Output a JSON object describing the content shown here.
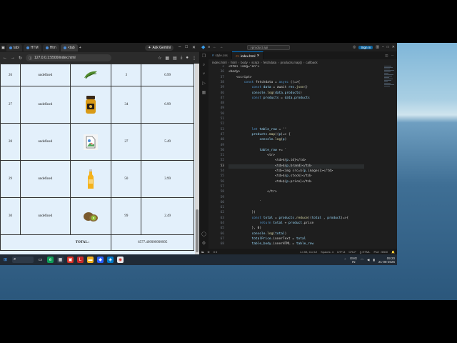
{
  "browser": {
    "tabs": [
      "tabl",
      "HTM",
      "Htm",
      "<tab"
    ],
    "ask_gemini": "Ask Gemini",
    "url": "127.0.0.1:5500/index.html",
    "table": {
      "rows": [
        {
          "id": "26",
          "brand": "undefined",
          "image": "green-bean-icon",
          "stock": "3",
          "price": "0.99"
        },
        {
          "id": "27",
          "brand": "undefined",
          "image": "honey-jar-icon",
          "stock": "34",
          "price": "6.99"
        },
        {
          "id": "28",
          "brand": "undefined",
          "image": "broken-image-icon",
          "stock": "27",
          "price": "5.49"
        },
        {
          "id": "29",
          "brand": "undefined",
          "image": "juice-bottle-icon",
          "stock": "50",
          "price": "3.99"
        },
        {
          "id": "30",
          "brand": "undefined",
          "image": "kiwi-icon",
          "stock": "99",
          "price": "2.49"
        }
      ],
      "total_label": "TOTAL :",
      "total_value": "6577.499999999995"
    },
    "scroll_position": 0.92
  },
  "vscode": {
    "title_search": "product api",
    "sign_in": "Sign in",
    "tabs": [
      "style.css",
      "index.html"
    ],
    "breadcrumbs": [
      "index.html",
      "html",
      "body",
      "script",
      "fetchdata",
      "products.map()",
      "callback"
    ],
    "status_left": "0 0",
    "status_right": [
      "Ln 53, Col 12",
      "Spaces: 4",
      "UTF-8",
      "CRLF",
      "{} HTML",
      "Port : 5500"
    ],
    "code_lines": [
      {
        "n": "2",
        "text": "<html lang=\"en\">"
      },
      {
        "n": "36",
        "text": "<body>"
      },
      {
        "n": "37",
        "text": "    <script>"
      },
      {
        "n": "38",
        "text": "        const fetchdata = async ()=>{"
      },
      {
        "n": "39",
        "text": "            const data = await res.json()"
      },
      {
        "n": "46",
        "text": "            console.log(data.products)"
      },
      {
        "n": "47",
        "text": "            const products = data.products"
      },
      {
        "n": "48",
        "text": ""
      },
      {
        "n": "49",
        "text": ""
      },
      {
        "n": "50",
        "text": ""
      },
      {
        "n": "51",
        "text": ""
      },
      {
        "n": "52",
        "text": ""
      },
      {
        "n": "53",
        "text": "            let table_row = ''"
      },
      {
        "n": "47",
        "text": "            products.map((p)=> {"
      },
      {
        "n": "48",
        "text": "                console.log(p)"
      },
      {
        "n": "49",
        "text": ""
      },
      {
        "n": "50",
        "text": "                table_row += `"
      },
      {
        "n": "51",
        "text": "                    <tr>"
      },
      {
        "n": "52",
        "text": "                        <td>${p.id}</td>"
      },
      {
        "n": "53",
        "text": "                        <td>${p.brand}</td>"
      },
      {
        "n": "54",
        "text": "                        <td><img src=${p.images}></td>"
      },
      {
        "n": "55",
        "text": "                        <td>${p.stock}</td>"
      },
      {
        "n": "56",
        "text": "                        <td>${p.price}</td>"
      },
      {
        "n": "57",
        "text": ""
      },
      {
        "n": "58",
        "text": "                    </tr>"
      },
      {
        "n": "59",
        "text": ""
      },
      {
        "n": "60",
        "text": "                `"
      },
      {
        "n": "61",
        "text": ""
      },
      {
        "n": "62",
        "text": "            })"
      },
      {
        "n": "63",
        "text": "            const total = products.reduce((total , product)=>{"
      },
      {
        "n": "64",
        "text": "                return total + product.price"
      },
      {
        "n": "65",
        "text": "            }, 0)"
      },
      {
        "n": "66",
        "text": "            console.log(total)"
      },
      {
        "n": "67",
        "text": "            totalPrice.innerText = total"
      },
      {
        "n": "68",
        "text": "            table_body.innerHTML = table_row"
      }
    ]
  },
  "taskbar": {
    "lang": "ENG",
    "region": "IN",
    "time": "09:20",
    "date": "21-08-2026"
  }
}
